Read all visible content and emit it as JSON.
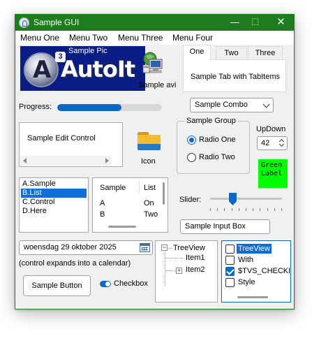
{
  "window": {
    "title": "Sample GUI",
    "accent": "#1e7c1e",
    "close_glyph": "✕",
    "min_glyph": "—",
    "max_glyph": "☐"
  },
  "menu": {
    "items": [
      "Menu One",
      "Menu Two",
      "Menu Three",
      "Menu Four"
    ]
  },
  "picture": {
    "caption": "Sample Pic",
    "logo_superscript": "3",
    "logo_text": "AutoIt",
    "background": "#0a1d85"
  },
  "avi": {
    "label": "Sample avi",
    "icon": "computer-network-icon"
  },
  "tabs": {
    "items": [
      "One",
      "Two",
      "Three"
    ],
    "active_index": 0,
    "content": "Sample Tab with TabItems"
  },
  "progress": {
    "label": "Progress:",
    "value_percent": 61,
    "color": "#0d67c7"
  },
  "combo": {
    "value": "Sample Combo"
  },
  "edit": {
    "text": "Sample Edit Control"
  },
  "icon_control": {
    "label": "Icon",
    "icon": "folder-icon"
  },
  "group": {
    "title": "Sample Group",
    "radios": [
      {
        "label": "Radio One",
        "checked": true
      },
      {
        "label": "Radio Two",
        "checked": false
      }
    ]
  },
  "updown": {
    "label": "UpDown",
    "value": "42"
  },
  "green_label": {
    "line1": "Green",
    "line2": "Label",
    "color": "#00ff00"
  },
  "listbox": {
    "items": [
      "A.Sample",
      "B.List",
      "C.Control",
      "D.Here"
    ],
    "selected_index": 1
  },
  "listview": {
    "columns": [
      "Sample",
      "List"
    ],
    "rows": [
      [
        "A",
        "On"
      ],
      [
        "B",
        "Two"
      ]
    ]
  },
  "slider": {
    "label": "Slider:",
    "value_fraction": 0.31,
    "ticks": 11
  },
  "input_box": {
    "value": "Sample Input Box"
  },
  "date": {
    "value": "woensdag 29 oktober 2025",
    "hint": "(control expands into a calendar)"
  },
  "button": {
    "label": "Sample Button"
  },
  "checkbox": {
    "label": "Checkbox",
    "checked": true
  },
  "treeview": {
    "root": "TreeView",
    "children": [
      "Item1",
      "Item2"
    ]
  },
  "check_tree": {
    "items": [
      {
        "label": "TreeView",
        "checked": false,
        "selected": true
      },
      {
        "label": "With",
        "checked": false,
        "selected": false
      },
      {
        "label": "$TVS_CHECKBOXES",
        "checked": true,
        "selected": false
      },
      {
        "label": "Style",
        "checked": false,
        "selected": false
      }
    ]
  }
}
